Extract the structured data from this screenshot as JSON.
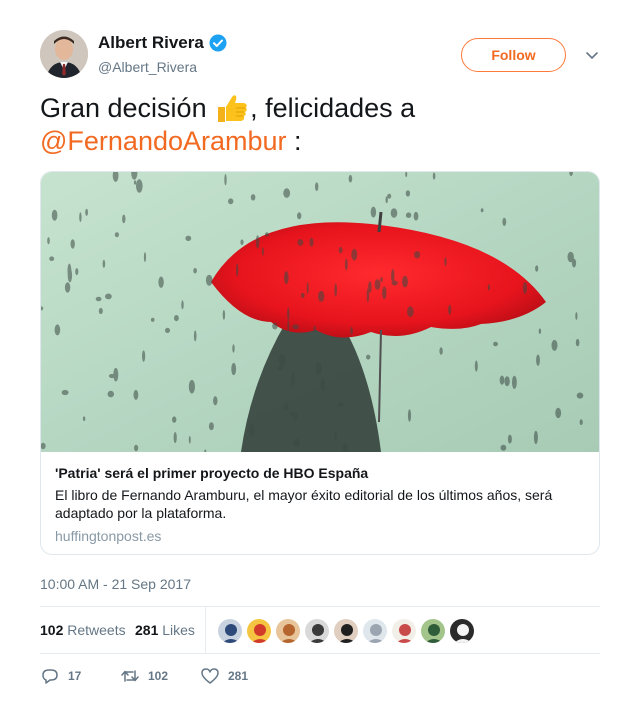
{
  "author": {
    "display_name": "Albert Rivera",
    "handle": "@Albert_Rivera",
    "verified": true,
    "verified_color": "#1da1f2"
  },
  "follow_label": "Follow",
  "accent_color": "#f26a22",
  "tweet": {
    "text_before_emoji": "Gran decisión ",
    "emoji": "thumbs-up-icon",
    "text_after_emoji": ", felicidades a",
    "mention": "@FernandoArambur",
    "text_end": " :"
  },
  "card": {
    "image": "red-umbrella-rain-photo",
    "title": "'Patria' será el primer proyecto de HBO España",
    "description": "El libro de Fernando Aramburu, el mayor éxito editorial de los últimos años, será adaptado por la plataforma.",
    "domain": "huffingtonpost.es"
  },
  "timestamp": "10:00 AM - 21 Sep 2017",
  "stats": {
    "retweets_count": "102",
    "retweets_label": "Retweets",
    "likes_count": "281",
    "likes_label": "Likes"
  },
  "likers": [
    "liker-avatar",
    "liker-avatar",
    "liker-avatar",
    "liker-avatar",
    "liker-avatar",
    "liker-avatar",
    "liker-avatar",
    "liker-avatar",
    "liker-avatar"
  ],
  "actions": {
    "reply_count": "17",
    "retweet_count": "102",
    "like_count": "281"
  }
}
